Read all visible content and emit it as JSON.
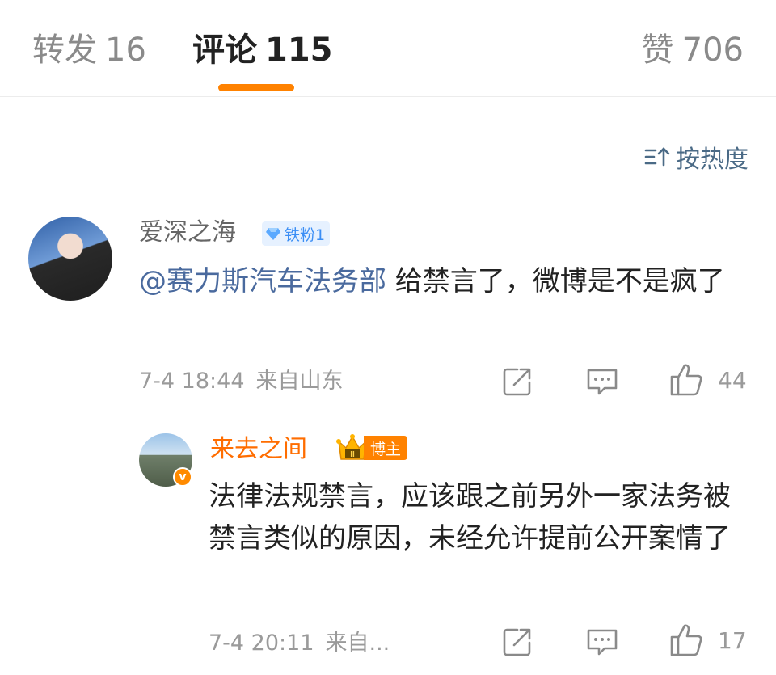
{
  "tabs": {
    "repost": {
      "label": "转发",
      "count": "16"
    },
    "comments": {
      "label": "评论",
      "count": "115"
    },
    "likes": {
      "label": "赞",
      "count": "706"
    }
  },
  "sort": {
    "label": "按热度",
    "icon": "sort-icon"
  },
  "comments": [
    {
      "username": "爱深之海",
      "badge": "铁粉1",
      "mention": "@赛力斯汽车法务部",
      "text": " 给禁言了，微博是不是疯了",
      "time": "7-4 18:44",
      "source": "来自山东",
      "like_count": "44"
    }
  ],
  "reply": {
    "username": "来去之间",
    "crown_level": "II",
    "badge": "博主",
    "verified_mark": "v",
    "text": "法律法规禁言，应该跟之前另外一家法务被禁言类似的原因，未经允许提前公开案情了",
    "time": "7-4 20:11",
    "source": "来自...",
    "like_count": "17"
  },
  "colors": {
    "accent": "#ff8200",
    "link": "#4a6a9e",
    "fan_badge": "#3b8ef5",
    "muted": "#9a9a9a"
  }
}
